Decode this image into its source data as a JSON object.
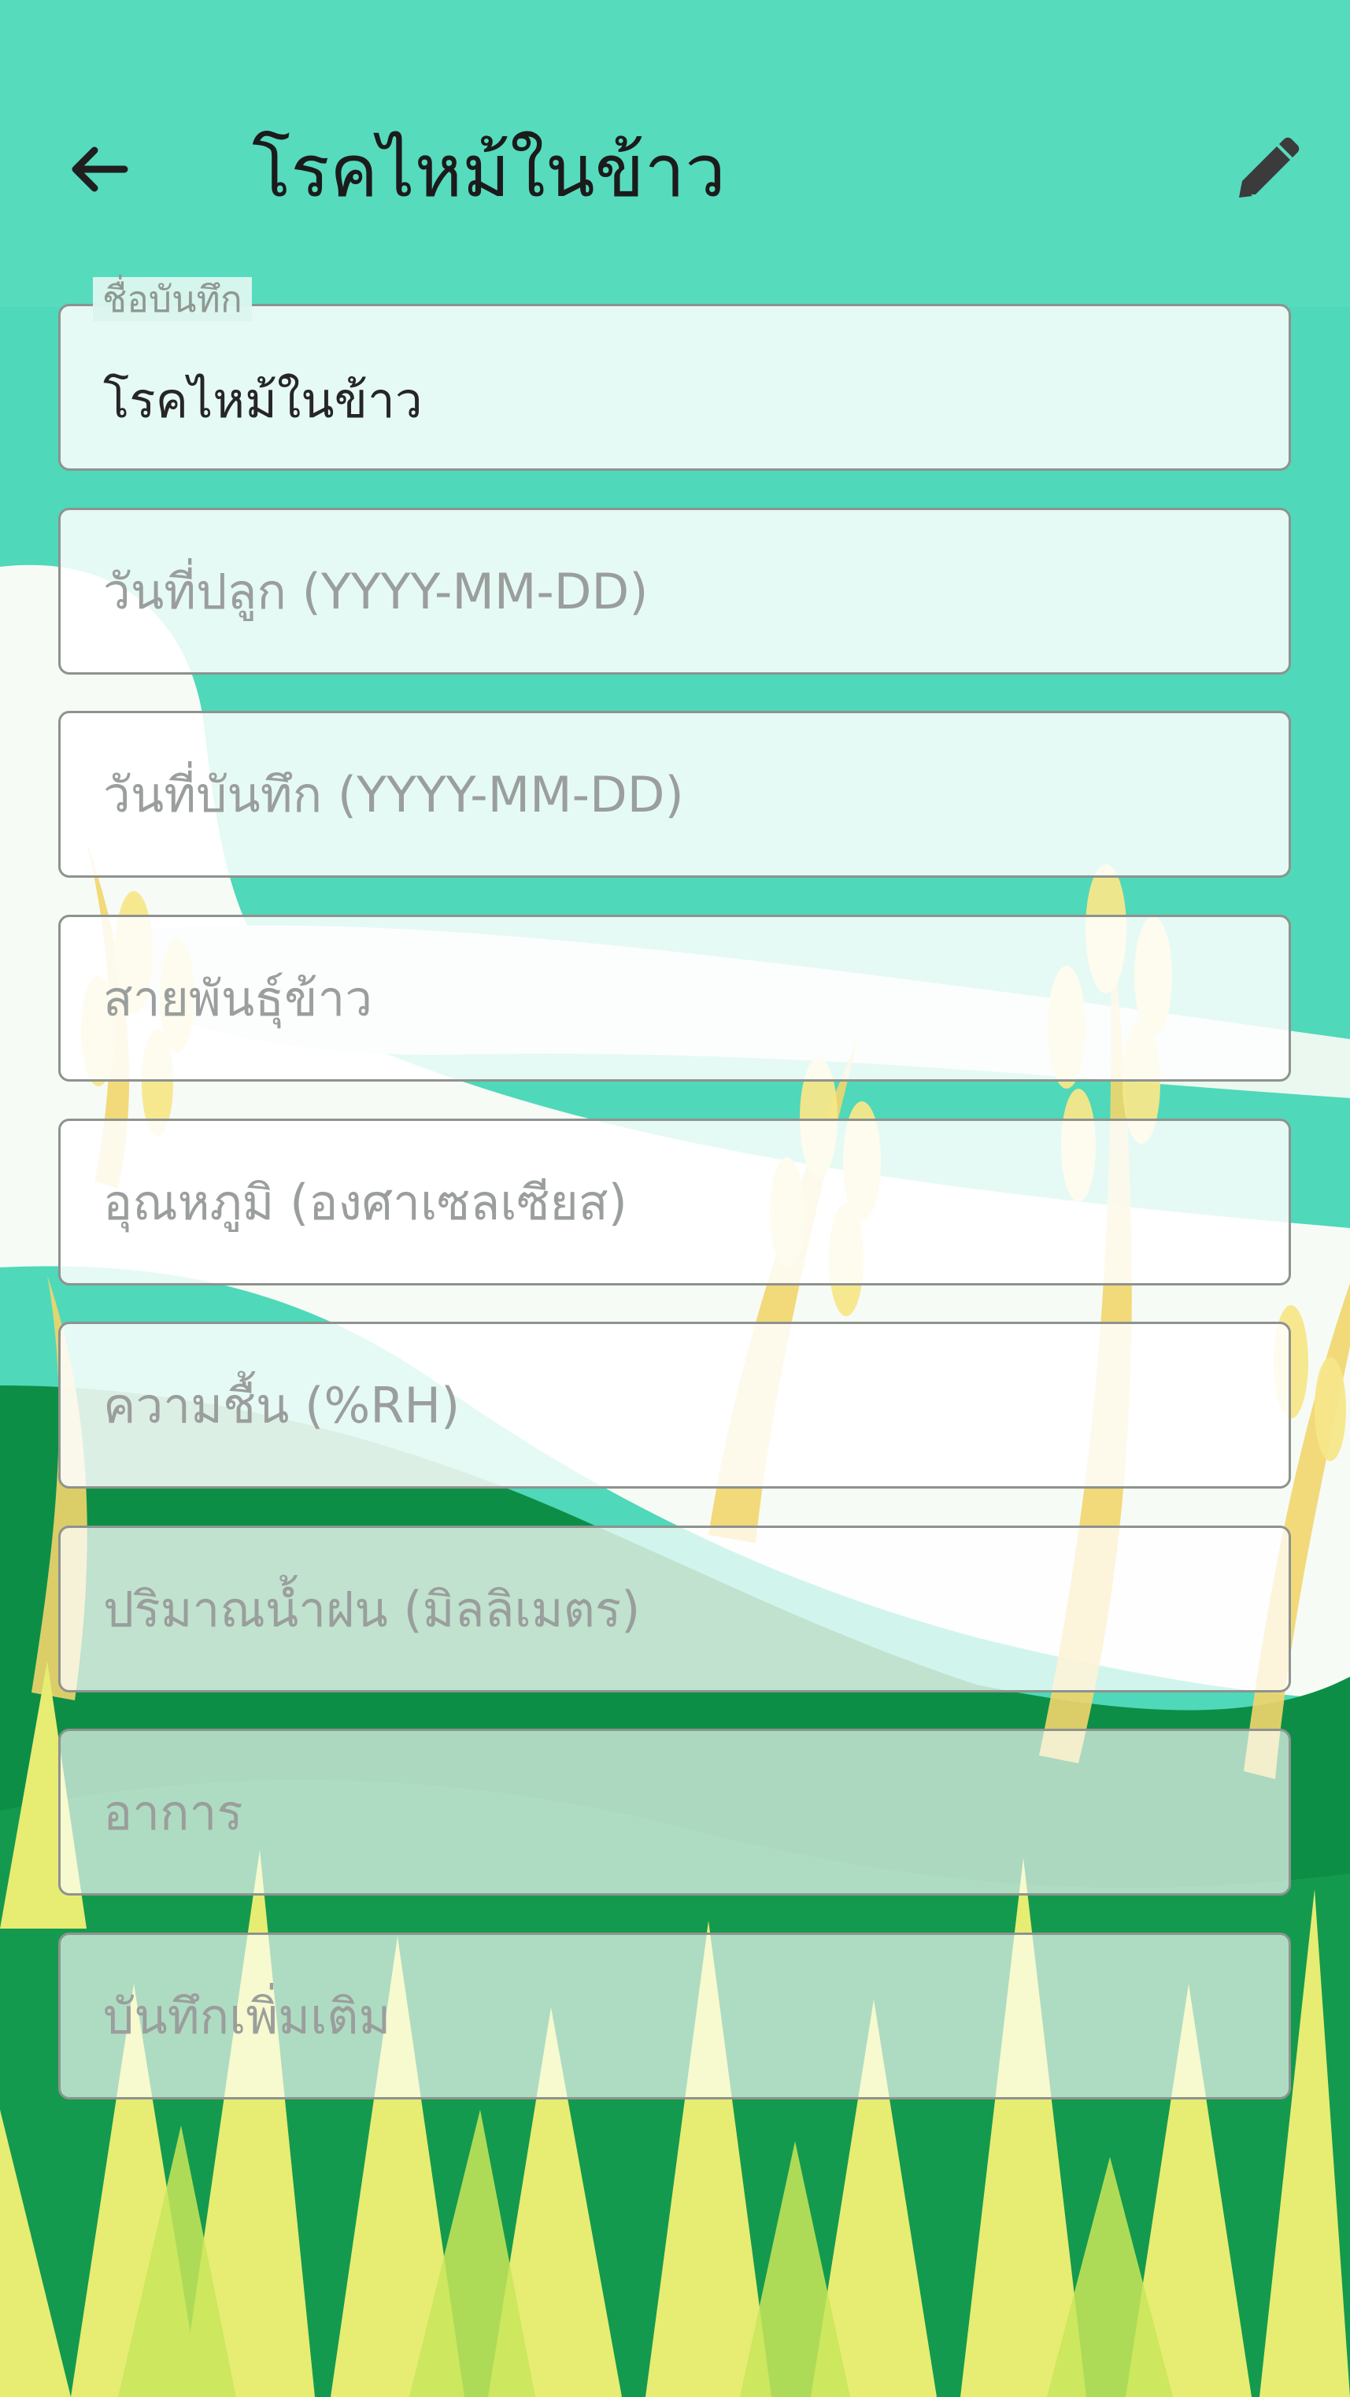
{
  "header": {
    "title": "โรคไหม้ในข้าว",
    "back_icon": "arrow-left-icon",
    "edit_icon": "pencil-icon"
  },
  "form": {
    "record_name": {
      "label": "ชื่อบันทึก",
      "value": "โรคไหม้ในข้าว"
    },
    "planting_date": {
      "placeholder": "วันที่ปลูก (YYYY-MM-DD)"
    },
    "record_date": {
      "placeholder": "วันที่บันทึก (YYYY-MM-DD)"
    },
    "rice_variety": {
      "placeholder": "สายพันธุ์ข้าว"
    },
    "temperature": {
      "placeholder": "อุณหภูมิ (องศาเซลเซียส)"
    },
    "humidity": {
      "placeholder": "ความชื้น (%RH)"
    },
    "rainfall": {
      "placeholder": "ปริมาณน้ำฝน (มิลลิเมตร)"
    },
    "symptoms": {
      "placeholder": "อาการ"
    },
    "notes": {
      "placeholder": "บันทึกเพิ่มเติม"
    }
  },
  "colors": {
    "sky": "#4fd8b9",
    "cloud": "#f6fbf6",
    "field_green": "#0d8e47",
    "grass_yellow": "#e7ec73",
    "wheat": "#f5d77a"
  }
}
